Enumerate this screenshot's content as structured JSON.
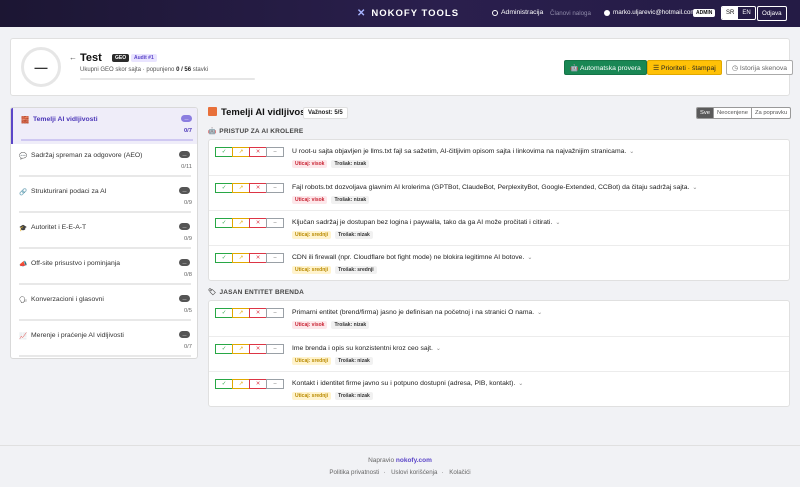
{
  "navbar": {
    "brand": "NOKOFY TOOLS",
    "admin": "Administracija",
    "members": "Članovi naloga",
    "email": "marko.uljarevic@hotmail.com",
    "admin_badge": "ADMIN",
    "lang_sr": "SR",
    "lang_en": "EN",
    "logout": "Odjava"
  },
  "header": {
    "score": "—",
    "back": "←",
    "title": "Test",
    "geo_tag": "GEO",
    "audit_tag": "Audit #1",
    "score_label": "Ukupni GEO skor sajta · popunjeno",
    "progress": "0 / 56",
    "items_word": "stavki",
    "progress_fraction": 0,
    "btn_auto": "Automatska provera",
    "btn_priority": "Prioriteti · štampaj",
    "btn_history": "Istorija skenova"
  },
  "sidebar": {
    "items": [
      {
        "icon": "🧱",
        "label": "Temelji AI vidljivosti",
        "pill": "—",
        "count": "0/7",
        "active": true
      },
      {
        "icon": "💬",
        "label": "Sadržaj spreman za odgovore (AEO)",
        "pill": "—",
        "count": "0/11"
      },
      {
        "icon": "🔗",
        "label": "Strukturirani podaci za AI",
        "pill": "—",
        "count": "0/9"
      },
      {
        "icon": "🎓",
        "label": "Autoritet i E-E-A-T",
        "pill": "—",
        "count": "0/9"
      },
      {
        "icon": "📣",
        "label": "Off-site prisustvo i pominjanja",
        "pill": "—",
        "count": "0/8"
      },
      {
        "icon": "🗣",
        "label": "Konverzacioni i glasovni",
        "pill": "—",
        "count": "0/5"
      },
      {
        "icon": "📈",
        "label": "Merenje i praćenje AI vidljivosti",
        "pill": "—",
        "count": "0/7"
      }
    ]
  },
  "main": {
    "title": "Temelji AI vidljivosti",
    "importance": "Važnost: 5/5",
    "filters": [
      "Sve",
      "Neocenjene",
      "Za popravku"
    ],
    "buttons": {
      "ok": "✓",
      "partial": "↗",
      "no": "✕",
      "na": "–"
    },
    "sections": [
      {
        "icon": "🤖",
        "title": "PRISTUP ZA AI KROLERE",
        "items": [
          {
            "text": "U root-u sajta objavljen je llms.txt fajl sa sažetim, AI-čitljivim opisom sajta i linkovima na najvažnijim stranicama.",
            "impact": "Uticaj: visok",
            "impact_level": "high",
            "cost": "Trošak: nizak"
          },
          {
            "text": "Fajl robots.txt dozvoljava glavnim AI krolerima (GPTBot, ClaudeBot, PerplexityBot, Google-Extended, CCBot) da čitaju sadržaj sajta.",
            "impact": "Uticaj: visok",
            "impact_level": "high",
            "cost": "Trošak: nizak"
          },
          {
            "text": "Ključan sadržaj je dostupan bez logina i paywalla, tako da ga AI može pročitati i citirati.",
            "impact": "Uticaj: srednji",
            "impact_level": "mid",
            "cost": "Trošak: nizak"
          },
          {
            "text": "CDN ili firewall (npr. Cloudflare bot fight mode) ne blokira legitimne AI botove.",
            "impact": "Uticaj: srednji",
            "impact_level": "mid",
            "cost": "Trošak: srednji"
          }
        ]
      },
      {
        "icon": "🏷",
        "title": "JASAN ENTITET BRENDA",
        "items": [
          {
            "text": "Primarni entitet (brend/firma) jasno je definisan na početnoj i na stranici O nama.",
            "impact": "Uticaj: visok",
            "impact_level": "high",
            "cost": "Trošak: nizak"
          },
          {
            "text": "Ime brenda i opis su konzistentni kroz ceo sajt.",
            "impact": "Uticaj: srednji",
            "impact_level": "mid",
            "cost": "Trošak: nizak"
          },
          {
            "text": "Kontakt i identitet firme javno su i potpuno dostupni (adresa, PIB, kontakt).",
            "impact": "Uticaj: srednji",
            "impact_level": "mid",
            "cost": "Trošak: nizak"
          }
        ]
      }
    ]
  },
  "footer": {
    "made_by": "Napravio",
    "made_link": "nokofy.com",
    "links": [
      "Politika privatnosti",
      "Uslovi korišćenja",
      "Kolačići"
    ]
  },
  "colors": {
    "accent": "#5b45c8",
    "success": "#198754",
    "warning": "#ffc107",
    "danger": "#dc3545"
  }
}
